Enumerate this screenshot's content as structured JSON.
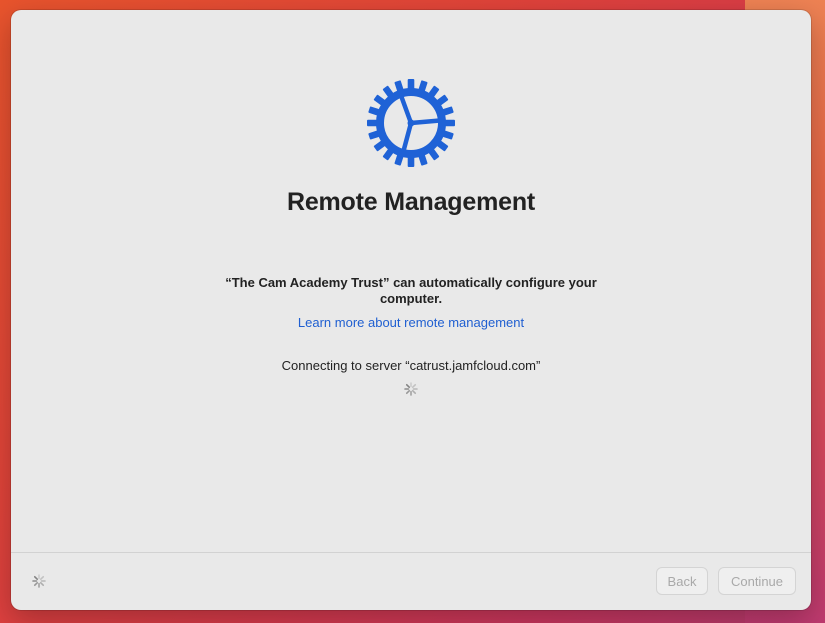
{
  "dialog": {
    "title": "Remote Management",
    "organization_message": "“The Cam Academy Trust” can automatically configure your computer.",
    "learn_more_link": "Learn more about remote management",
    "status_message": "Connecting to server “catrust.jamfcloud.com”"
  },
  "footer": {
    "back_label": "Back",
    "continue_label": "Continue"
  },
  "icons": {
    "header": "gear-icon",
    "loading": "spinner-icon"
  },
  "colors": {
    "gear_blue": "#1f62d6",
    "link_blue": "#1f5fd1",
    "window_bg": "#e9e9e9"
  }
}
